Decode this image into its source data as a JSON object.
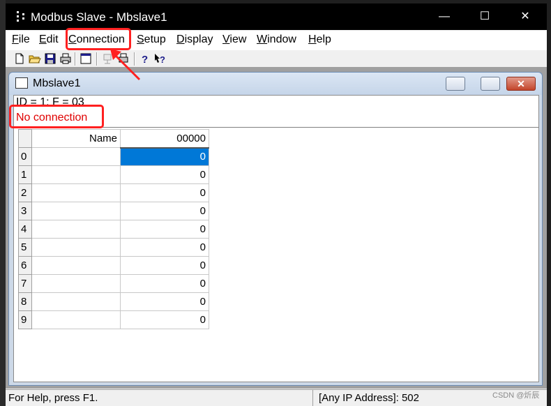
{
  "window": {
    "title": "Modbus Slave - Mbslave1",
    "controls": {
      "minimize": "—",
      "maximize": "☐",
      "close": "✕"
    }
  },
  "menu": [
    "File",
    "Edit",
    "Connection",
    "Setup",
    "Display",
    "View",
    "Window",
    "Help"
  ],
  "toolbar": {
    "buttons": [
      "new-icon",
      "open-icon",
      "save-icon",
      "print-icon",
      "window-icon",
      "disconnect-icon",
      "print-preview-icon",
      "help-icon",
      "context-help-icon"
    ]
  },
  "child": {
    "title": "Mbslave1",
    "info": "ID = 1: F = 03",
    "status": "No connection",
    "grid": {
      "headers": {
        "name": "Name",
        "value": "00000"
      },
      "rows": [
        {
          "index": "0",
          "name": "",
          "value": "0",
          "selected": true
        },
        {
          "index": "1",
          "name": "",
          "value": "0"
        },
        {
          "index": "2",
          "name": "",
          "value": "0"
        },
        {
          "index": "3",
          "name": "",
          "value": "0"
        },
        {
          "index": "4",
          "name": "",
          "value": "0"
        },
        {
          "index": "5",
          "name": "",
          "value": "0"
        },
        {
          "index": "6",
          "name": "",
          "value": "0"
        },
        {
          "index": "7",
          "name": "",
          "value": "0"
        },
        {
          "index": "8",
          "name": "",
          "value": "0"
        },
        {
          "index": "9",
          "name": "",
          "value": "0"
        }
      ]
    }
  },
  "statusbar": {
    "help": "For Help, press F1.",
    "address": "[Any IP Address]: 502"
  },
  "watermark": "CSDN @炘辰",
  "colors": {
    "annotation": "#ff2020",
    "selection": "#0078d7",
    "status_text": "#e00000"
  }
}
